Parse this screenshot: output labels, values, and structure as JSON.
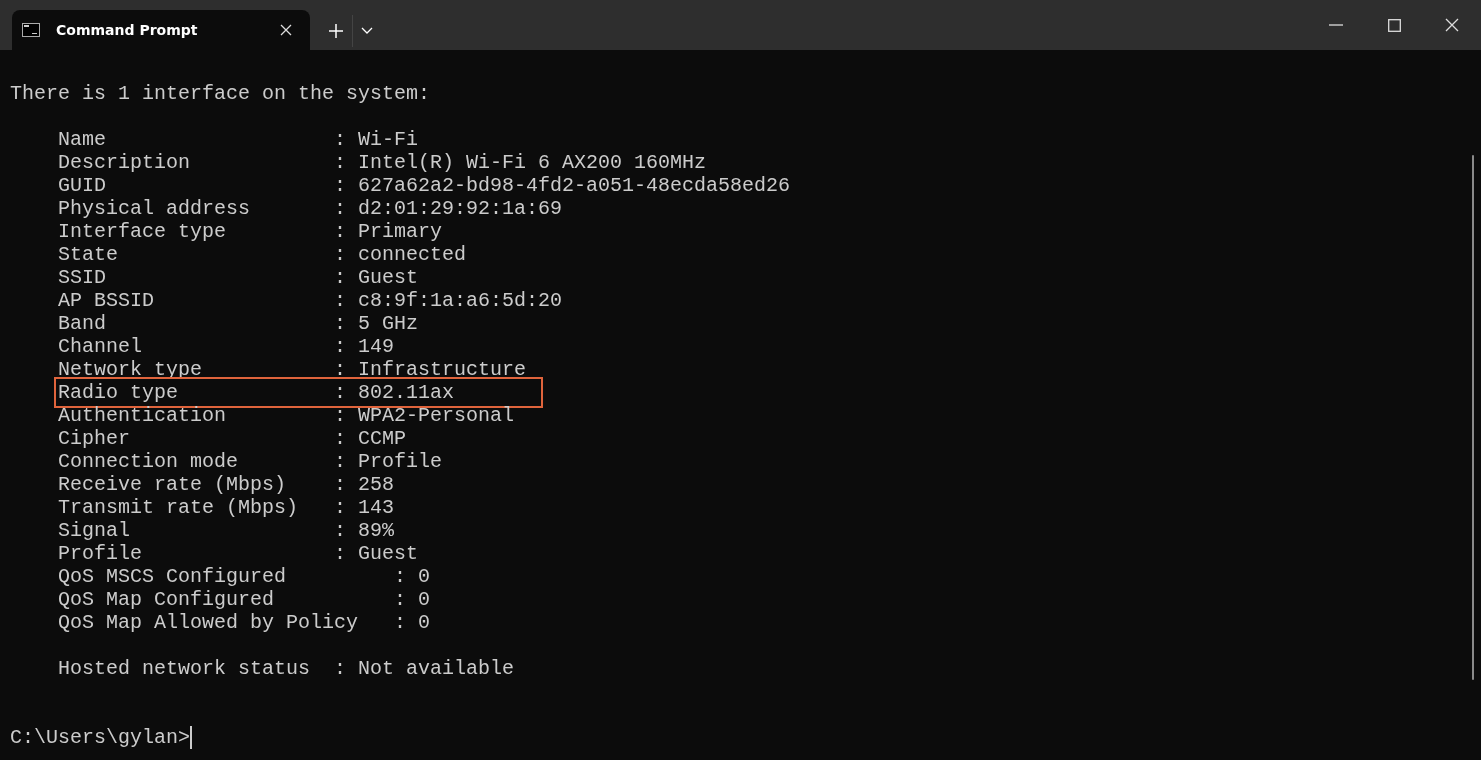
{
  "tab": {
    "title": "Command Prompt",
    "selected": true
  },
  "heading": "There is 1 interface on the system:",
  "fields": [
    {
      "text": "Name                   : Wi-Fi",
      "highlighted": false
    },
    {
      "text": "Description            : Intel(R) Wi-Fi 6 AX200 160MHz",
      "highlighted": false
    },
    {
      "text": "GUID                   : 627a62a2-bd98-4fd2-a051-48ecda58ed26",
      "highlighted": false
    },
    {
      "text": "Physical address       : d2:01:29:92:1a:69",
      "highlighted": false
    },
    {
      "text": "Interface type         : Primary",
      "highlighted": false
    },
    {
      "text": "State                  : connected",
      "highlighted": false
    },
    {
      "text": "SSID                   : Guest",
      "highlighted": false
    },
    {
      "text": "AP BSSID               : c8:9f:1a:a6:5d:20",
      "highlighted": false
    },
    {
      "text": "Band                   : 5 GHz",
      "highlighted": false
    },
    {
      "text": "Channel                : 149",
      "highlighted": false
    },
    {
      "text": "Network type           : Infrastructure",
      "highlighted": false
    },
    {
      "text": "Radio type             : 802.11ax",
      "highlighted": true
    },
    {
      "text": "Authentication         : WPA2-Personal",
      "highlighted": false
    },
    {
      "text": "Cipher                 : CCMP",
      "highlighted": false
    },
    {
      "text": "Connection mode        : Profile",
      "highlighted": false
    },
    {
      "text": "Receive rate (Mbps)    : 258",
      "highlighted": false
    },
    {
      "text": "Transmit rate (Mbps)   : 143",
      "highlighted": false
    },
    {
      "text": "Signal                 : 89%",
      "highlighted": false
    },
    {
      "text": "Profile                : Guest",
      "highlighted": false
    },
    {
      "text": "QoS MSCS Configured         : 0",
      "highlighted": false
    },
    {
      "text": "QoS Map Configured          : 0",
      "highlighted": false
    },
    {
      "text": "QoS Map Allowed by Policy   : 0",
      "highlighted": false
    }
  ],
  "hosted": "Hosted network status  : Not available",
  "prompt": "C:\\Users\\gylan>"
}
